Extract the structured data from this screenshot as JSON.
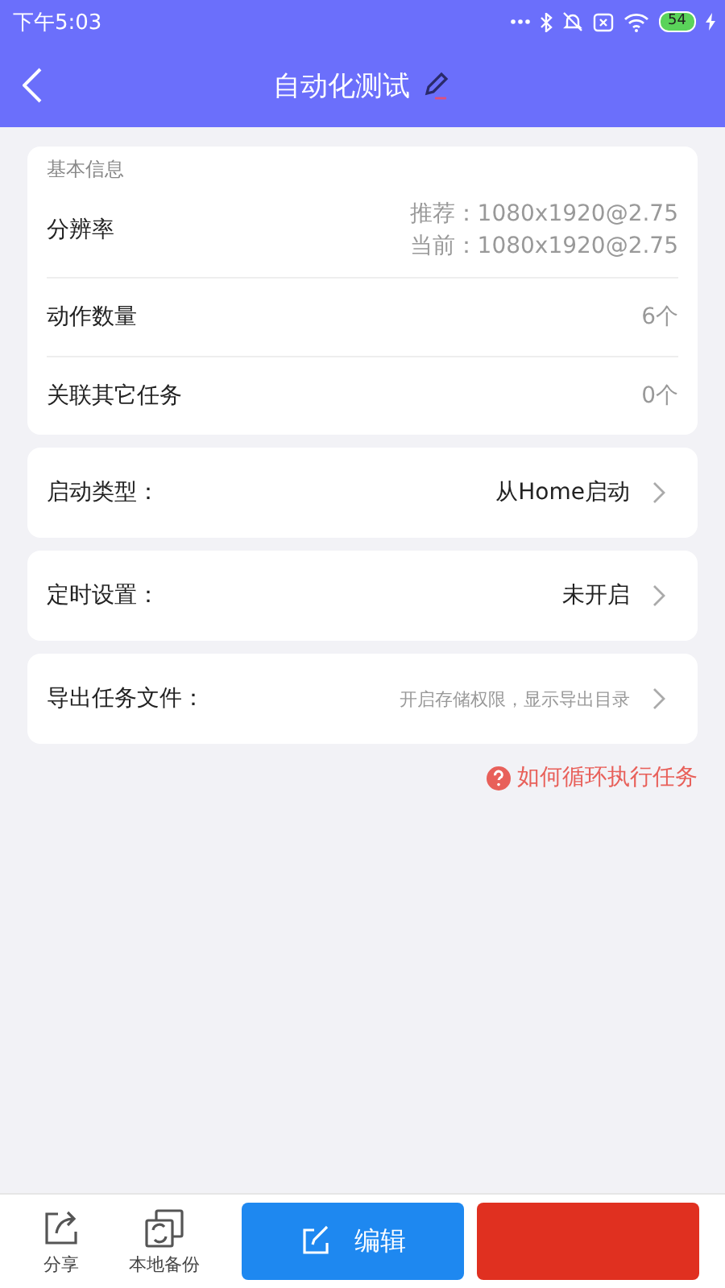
{
  "status_bar": {
    "time": "下午5:03",
    "battery": "54"
  },
  "header": {
    "title": "自动化测试"
  },
  "info_card": {
    "heading": "基本信息",
    "rows": [
      {
        "label": "分辨率",
        "values": [
          "推荐：1080x1920@2.75",
          "当前：1080x1920@2.75"
        ]
      },
      {
        "label": "动作数量",
        "values": [
          "6个"
        ]
      },
      {
        "label": "关联其它任务",
        "values": [
          "0个"
        ]
      }
    ]
  },
  "setting_cards": [
    {
      "label": "启动类型：",
      "value": "从Home启动",
      "kind": "normal"
    },
    {
      "label": "定时设置：",
      "value": "未开启",
      "kind": "normal"
    },
    {
      "label": "导出任务文件：",
      "value": "开启存储权限，显示导出目录",
      "kind": "hint"
    }
  ],
  "help_link": "如何循环执行任务",
  "bottom_bar": {
    "items": [
      {
        "label": "分享",
        "kind": "share"
      },
      {
        "label": "本地备份",
        "kind": "backup"
      }
    ],
    "primary_button": "编辑"
  }
}
